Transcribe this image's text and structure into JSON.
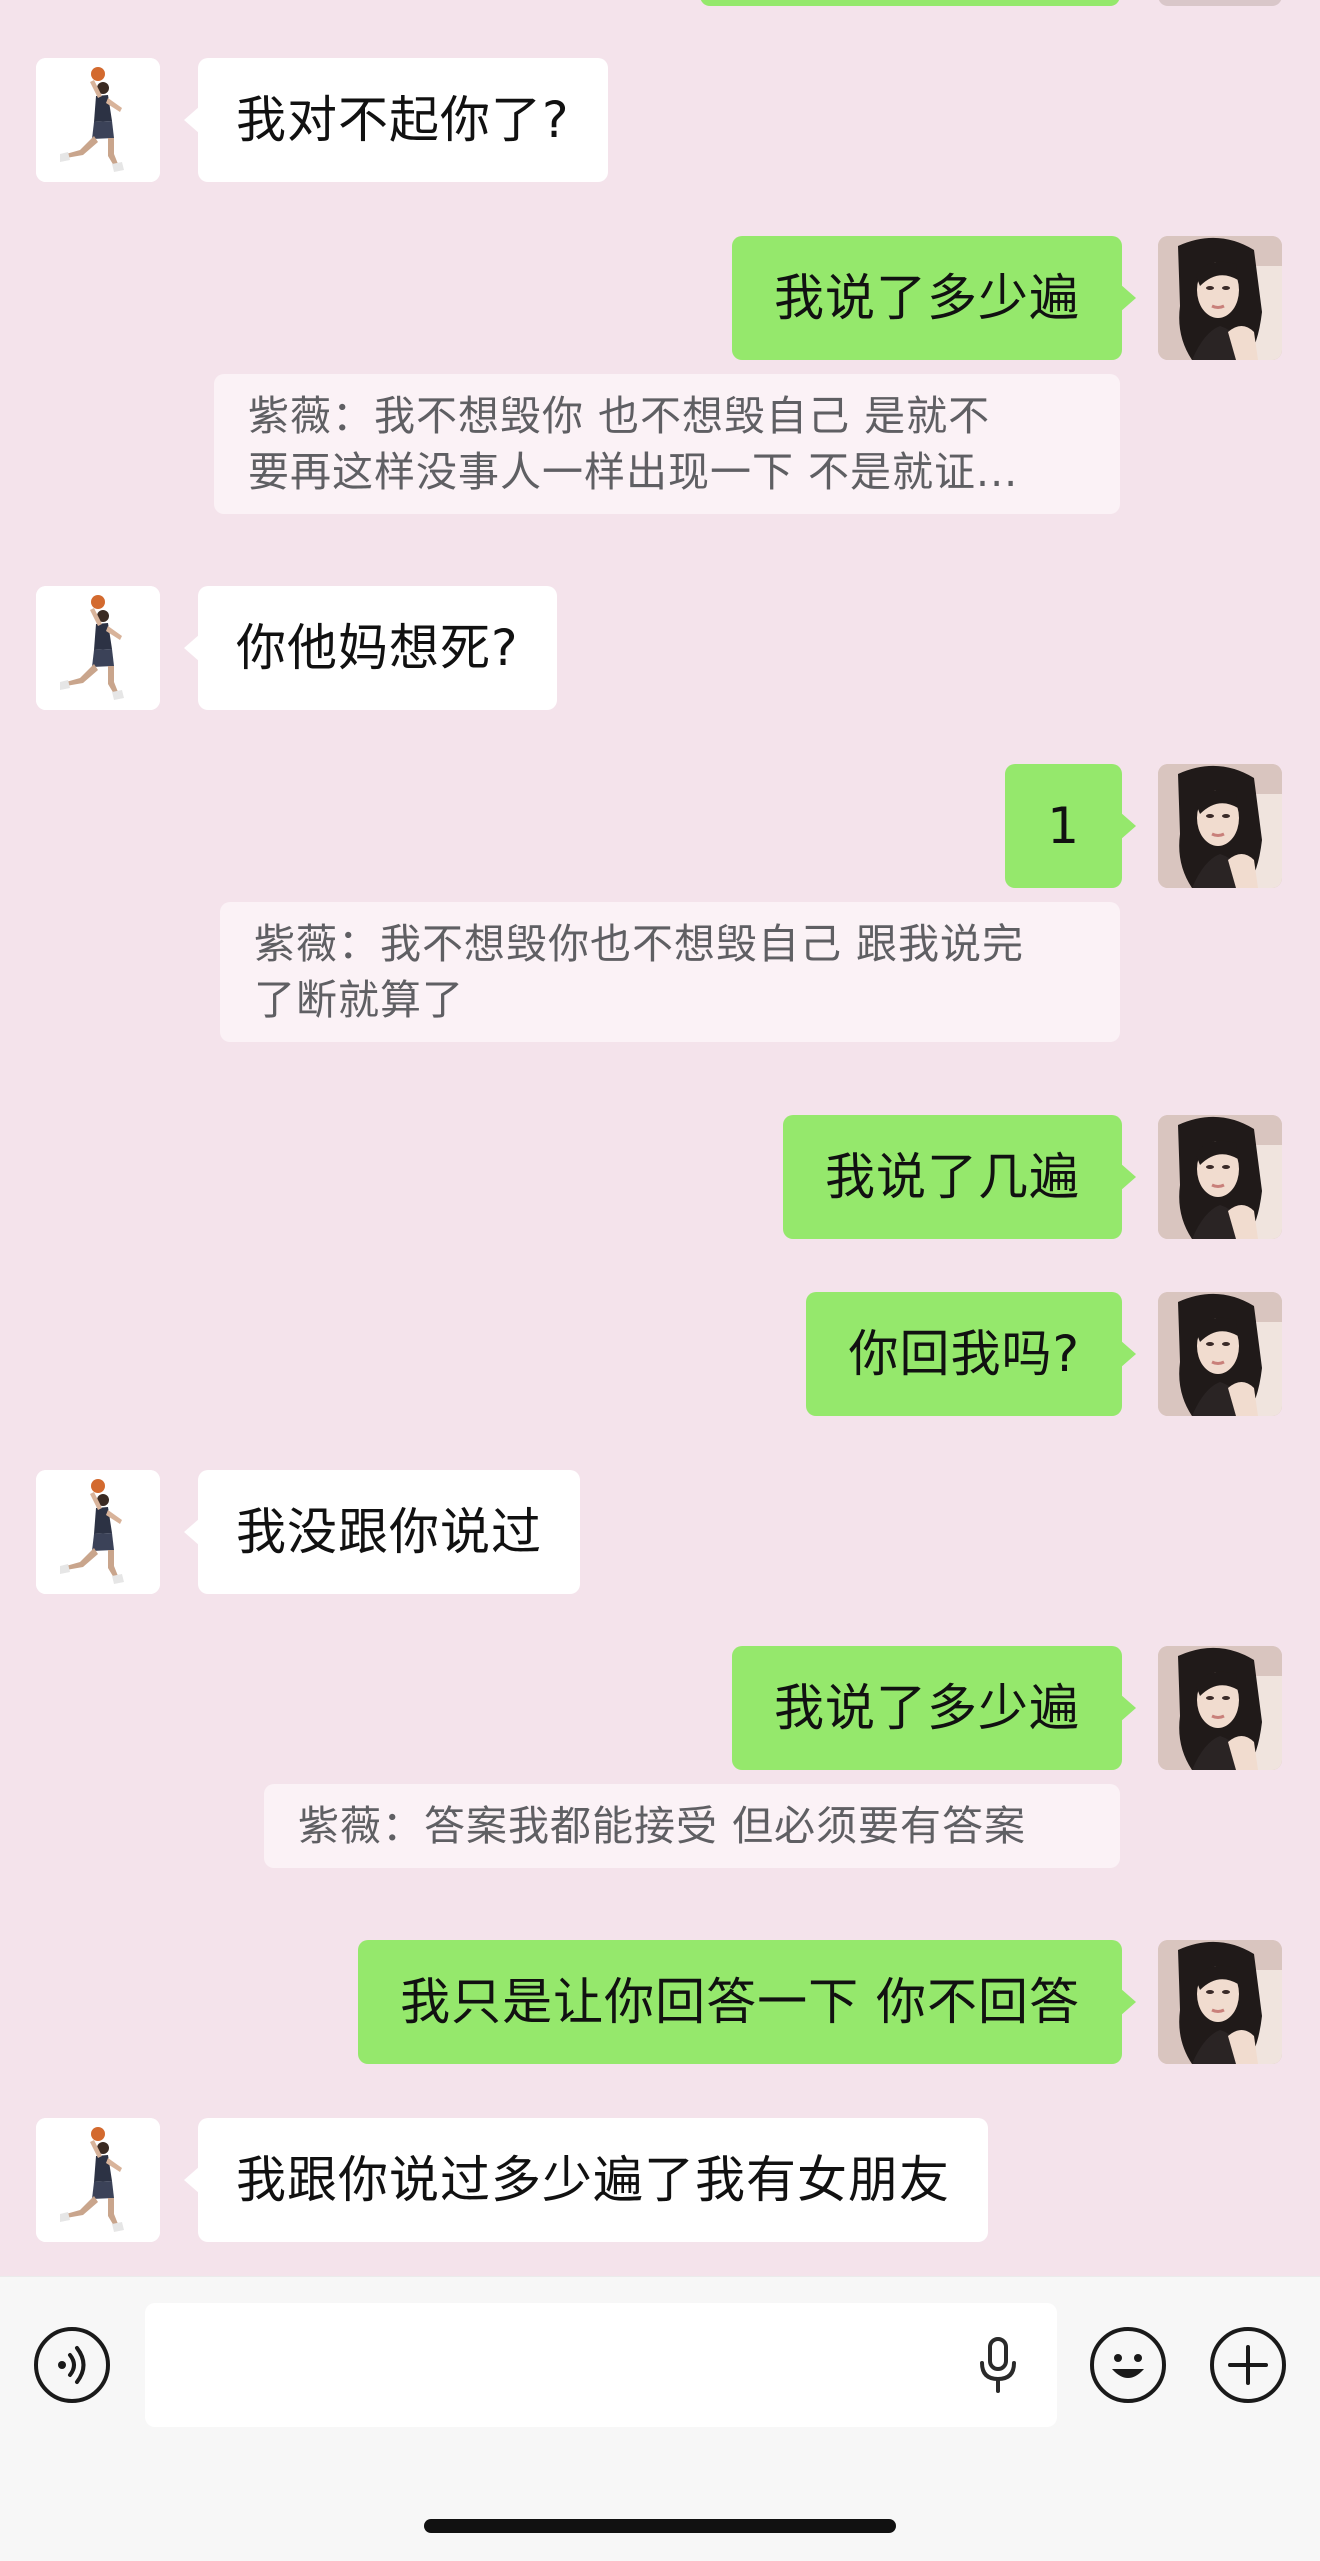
{
  "colors": {
    "background": "#f4e3eb",
    "sent_bubble": "#95e86c",
    "received_bubble": "#ffffff",
    "quote_bubble": "#fbf2f6",
    "quote_text": "#5f5f63"
  },
  "contacts": {
    "other_avatar_icon": "basketball-player-avatar",
    "self_avatar_icon": "woman-portrait-avatar"
  },
  "messages": [
    {
      "id": 0,
      "side": "left",
      "text": "我对不起你了?"
    },
    {
      "id": 1,
      "side": "right",
      "text": "我说了多少遍",
      "quote": [
        "紫薇：我不想毁你 也不想毁自己  是就不",
        "要再这样没事人一样出现一下  不是就证..."
      ]
    },
    {
      "id": 2,
      "side": "left",
      "text": "你他妈想死?"
    },
    {
      "id": 3,
      "side": "right",
      "text": "1",
      "quote": [
        "紫薇：我不想毁你也不想毁自己 跟我说完",
        "了断就算了"
      ]
    },
    {
      "id": 4,
      "side": "right",
      "text": "我说了几遍"
    },
    {
      "id": 5,
      "side": "right",
      "text": "你回我吗?"
    },
    {
      "id": 6,
      "side": "left",
      "text": "我没跟你说过"
    },
    {
      "id": 7,
      "side": "right",
      "text": "我说了多少遍",
      "quote": [
        "紫薇：答案我都能接受 但必须要有答案"
      ]
    },
    {
      "id": 8,
      "side": "right",
      "text": "我只是让你回答一下 你不回答"
    },
    {
      "id": 9,
      "side": "left",
      "text": "我跟你说过多少遍了我有女朋友"
    }
  ],
  "input_bar": {
    "voice_icon": "voice-toggle-icon",
    "mic_icon": "microphone-icon",
    "emoji_icon": "emoji-icon",
    "plus_icon": "plus-icon",
    "text_value": ""
  }
}
